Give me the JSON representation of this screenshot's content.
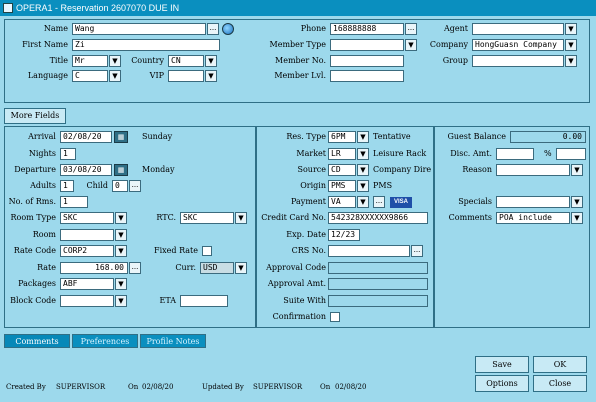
{
  "window": {
    "title": "OPERA1 - Reservation 2607070  DUE IN"
  },
  "guest": {
    "name_label": "Name",
    "name": "Wang",
    "first_name_label": "First Name",
    "first_name": "Zi",
    "title_label": "Title",
    "title": "Mr",
    "country_label": "Country",
    "country": "CN",
    "language_label": "Language",
    "language": "C",
    "vip_label": "VIP",
    "vip": "",
    "phone_label": "Phone",
    "phone": "168888888",
    "member_type_label": "Member Type",
    "member_type": "",
    "member_no_label": "Member No.",
    "member_no": "",
    "member_lvl_label": "Member Lvl.",
    "member_lvl": "",
    "agent_label": "Agent",
    "agent": "",
    "company_label": "Company",
    "company": "HongGuasn Company",
    "group_label": "Group",
    "group": ""
  },
  "more_fields_label": "More Fields",
  "stay": {
    "arrival_label": "Arrival",
    "arrival": "02/08/20",
    "arrival_day": "Sunday",
    "nights_label": "Nights",
    "nights": "1",
    "departure_label": "Departure",
    "departure": "03/08/20",
    "departure_day": "Monday",
    "adults_label": "Adults",
    "adults": "1",
    "child_label": "Child",
    "child": "0",
    "rooms_label": "No. of Rms.",
    "rooms": "1",
    "room_type_label": "Room Type",
    "room_type": "SKC",
    "rtc_label": "RTC.",
    "rtc": "SKC",
    "room_label": "Room",
    "room": "",
    "rate_code_label": "Rate Code",
    "rate_code": "CORP2",
    "fixed_rate_label": "Fixed Rate",
    "rate_label": "Rate",
    "rate": "168.00",
    "curr_label": "Curr.",
    "curr": "USD",
    "packages_label": "Packages",
    "packages": "ABF",
    "block_code_label": "Block Code",
    "block_code": "",
    "eta_label": "ETA",
    "eta": ""
  },
  "booking": {
    "res_type_label": "Res. Type",
    "res_type": "6PM",
    "res_type_desc": "Tentative",
    "market_label": "Market",
    "market": "LR",
    "market_desc": "Leisure Rack",
    "source_label": "Source",
    "source": "CD",
    "source_desc": "Company Dire",
    "origin_label": "Origin",
    "origin": "PMS",
    "origin_desc": "PMS",
    "payment_label": "Payment",
    "payment": "VA",
    "payment_badge": "VISA",
    "card_no_label": "Credit Card No.",
    "card_no": "542328XXXXXX9866",
    "exp_date_label": "Exp. Date",
    "exp_date": "12/23",
    "crs_no_label": "CRS No.",
    "crs_no": "",
    "approval_code_label": "Approval Code",
    "approval_code": "",
    "approval_amt_label": "Approval Amt.",
    "approval_amt": "",
    "suite_with_label": "Suite With",
    "suite_with": "",
    "confirmation_label": "Confirmation"
  },
  "account": {
    "guest_balance_label": "Guest Balance",
    "guest_balance": "0.00",
    "disc_amt_label": "Disc. Amt.",
    "disc_amt": "",
    "pct_label": "%",
    "disc_pct": "",
    "reason_label": "Reason",
    "reason": "",
    "specials_label": "Specials",
    "specials": "",
    "comments_label": "Comments",
    "comments": "POA   include"
  },
  "tabs": [
    "Comments",
    "Preferences",
    "Profile Notes"
  ],
  "buttons": {
    "save": "Save",
    "ok": "OK",
    "options": "Options",
    "close": "Close"
  },
  "footer": {
    "created_by_label": "Created By",
    "created_by": "SUPERVISOR",
    "created_on_label": "On",
    "created_on": "02/08/20",
    "updated_by_label": "Updated By",
    "updated_by": "SUPERVISOR",
    "updated_on_label": "On",
    "updated_on": "02/08/20"
  },
  "icons": {
    "dropdown": "down-arrow-icon",
    "lookup": "ellipsis-icon",
    "calendar": "calendar-icon",
    "globe": "globe-icon"
  },
  "colors": {
    "background": "#9dd9ec",
    "titlebar": "#0a8fbf",
    "tab": "#0a8fbf",
    "field": "#ffffff"
  }
}
